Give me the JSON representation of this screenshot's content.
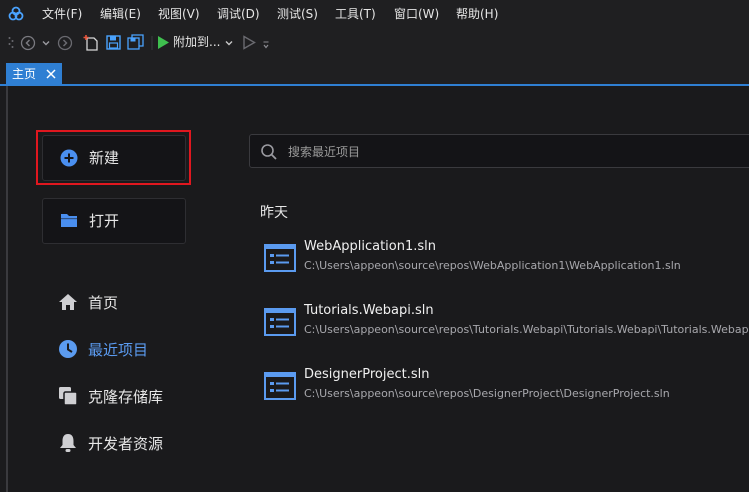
{
  "menu": {
    "items": [
      {
        "label": "文件(F)"
      },
      {
        "label": "编辑(E)"
      },
      {
        "label": "视图(V)"
      },
      {
        "label": "调试(D)"
      },
      {
        "label": "测试(S)"
      },
      {
        "label": "工具(T)"
      },
      {
        "label": "窗口(W)"
      },
      {
        "label": "帮助(H)"
      }
    ]
  },
  "toolbar": {
    "attach_label": "附加到..."
  },
  "tabs": [
    {
      "label": "主页"
    }
  ],
  "actions": {
    "new_label": "新建",
    "open_label": "打开"
  },
  "nav": {
    "items": [
      {
        "label": "首页",
        "icon": "home-icon"
      },
      {
        "label": "最近项目",
        "icon": "clock-icon",
        "active": true
      },
      {
        "label": "克隆存储库",
        "icon": "clone-icon"
      },
      {
        "label": "开发者资源",
        "icon": "bell-icon"
      }
    ]
  },
  "search": {
    "placeholder": "搜索最近项目"
  },
  "recent": {
    "section_label": "昨天",
    "items": [
      {
        "name": "WebApplication1.sln",
        "path": "C:\\Users\\appeon\\source\\repos\\WebApplication1\\WebApplication1.sln"
      },
      {
        "name": "Tutorials.Webapi.sln",
        "path": "C:\\Users\\appeon\\source\\repos\\Tutorials.Webapi\\Tutorials.Webapi\\Tutorials.Webapi.sln"
      },
      {
        "name": "DesignerProject.sln",
        "path": "C:\\Users\\appeon\\source\\repos\\DesignerProject\\DesignerProject.sln"
      }
    ]
  },
  "colors": {
    "accent": "#2f7fd3",
    "highlight": "#e0171f",
    "active_nav": "#5b9bf0",
    "background": "#1b1b1d"
  }
}
